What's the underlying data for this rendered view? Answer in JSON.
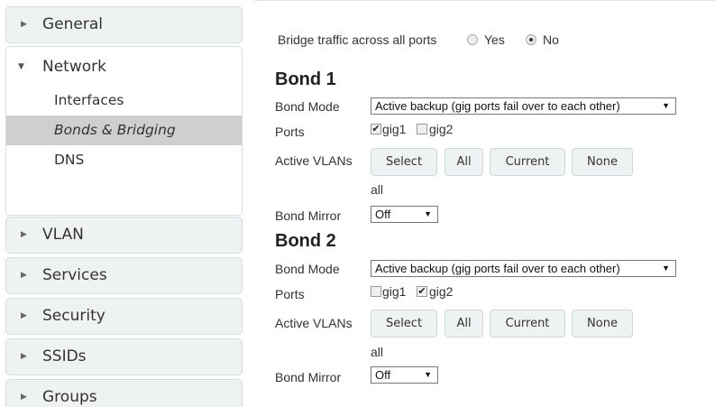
{
  "sidebar": {
    "general": "General",
    "network": {
      "label": "Network",
      "items": [
        "Interfaces",
        "Bonds & Bridging",
        "DNS"
      ],
      "active": "Bonds & Bridging"
    },
    "sections": [
      "VLAN",
      "Services",
      "Security",
      "SSIDs",
      "Groups"
    ]
  },
  "bridge": {
    "label": "Bridge traffic across all ports",
    "yes": "Yes",
    "no": "No",
    "selected": "No"
  },
  "bonds": [
    {
      "title": "Bond 1",
      "mode_label": "Bond Mode",
      "mode_value": "Active backup (gig ports fail over to each other)",
      "ports_label": "Ports",
      "ports": [
        {
          "name": "gig1",
          "checked": true
        },
        {
          "name": "gig2",
          "checked": false
        }
      ],
      "vlans_label": "Active VLANs",
      "buttons": [
        "Select",
        "All",
        "Current",
        "None"
      ],
      "vlans_value": "all",
      "mirror_label": "Bond Mirror",
      "mirror_value": "Off"
    },
    {
      "title": "Bond 2",
      "mode_label": "Bond Mode",
      "mode_value": "Active backup (gig ports fail over to each other)",
      "ports_label": "Ports",
      "ports": [
        {
          "name": "gig1",
          "checked": false
        },
        {
          "name": "gig2",
          "checked": true
        }
      ],
      "vlans_label": "Active VLANs",
      "buttons": [
        "Select",
        "All",
        "Current",
        "None"
      ],
      "vlans_value": "all",
      "mirror_label": "Bond Mirror",
      "mirror_value": "Off"
    }
  ],
  "icons": {
    "collapsed": "triangle-right-icon",
    "expanded": "triangle-down-icon",
    "select_caret": "caret-down-icon",
    "check": "check-icon"
  }
}
